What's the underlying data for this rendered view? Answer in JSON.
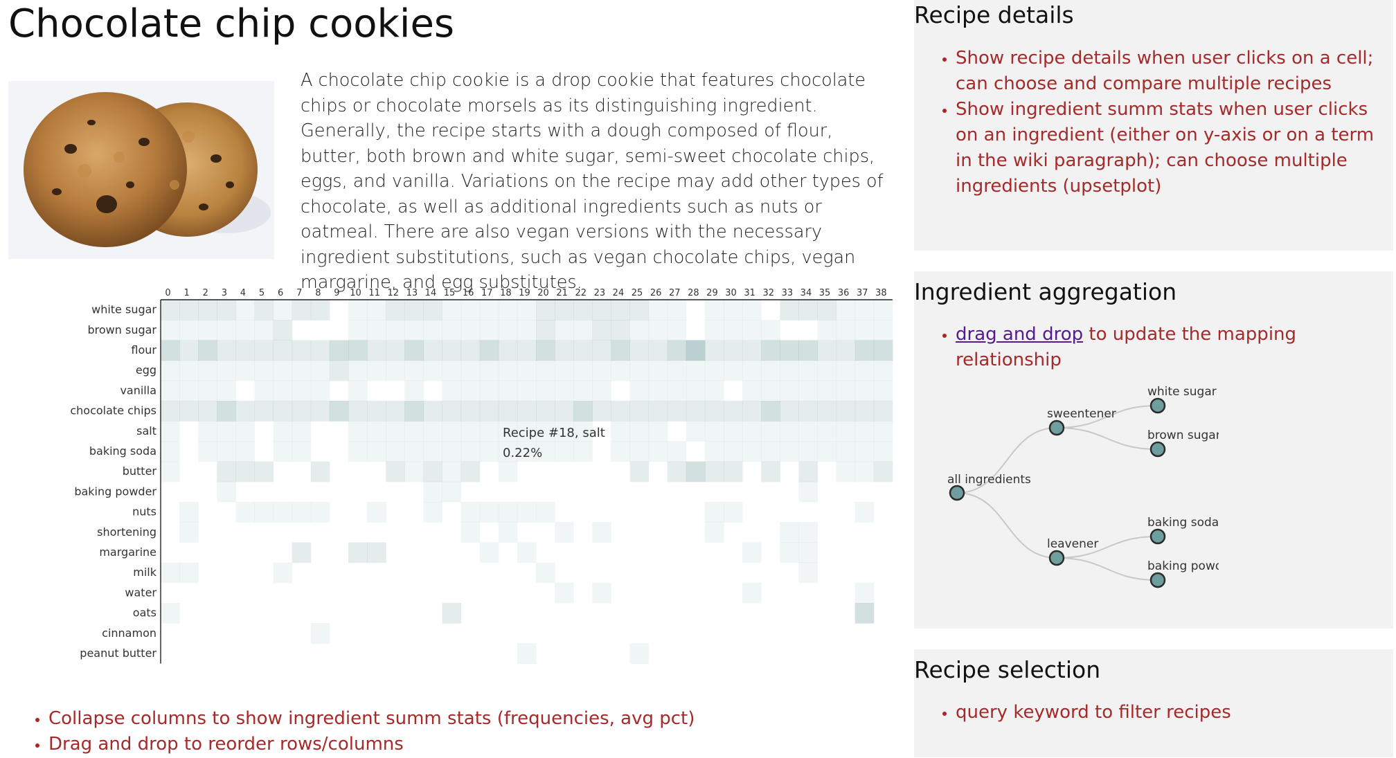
{
  "page": {
    "title": "Chocolate chip cookies",
    "intro": "A chocolate chip cookie is a drop cookie that features chocolate chips or chocolate morsels as its distinguishing ingredient. Generally, the recipe starts with a dough composed of flour, butter, both brown and white sugar, semi-sweet chocolate chips, eggs, and vanilla. Variations on the recipe may add other types of chocolate, as well as additional ingredients such as nuts or oatmeal. There are also vegan versions with the necessary ingredient substitutions, such as vegan chocolate chips, vegan margarine, and egg substitutes."
  },
  "heatmap": {
    "columns": [
      "0",
      "1",
      "2",
      "3",
      "4",
      "5",
      "6",
      "7",
      "8",
      "9",
      "10",
      "11",
      "12",
      "13",
      "14",
      "15",
      "16",
      "17",
      "18",
      "19",
      "20",
      "21",
      "22",
      "23",
      "24",
      "25",
      "26",
      "27",
      "28",
      "29",
      "30",
      "31",
      "32",
      "33",
      "34",
      "35",
      "36",
      "37",
      "38"
    ],
    "rows": [
      "white sugar",
      "brown sugar",
      "flour",
      "egg",
      "vanilla",
      "chocolate chips",
      "salt",
      "baking soda",
      "butter",
      "baking powder",
      "nuts",
      "shortening",
      "margarine",
      "milk",
      "water",
      "oats",
      "cinnamon",
      "peanut butter"
    ],
    "color": "#5e8e8e",
    "tooltip": {
      "line1": "Recipe #18, salt",
      "line2": "0.22%"
    }
  },
  "notes": [
    "Collapse columns to show ingredient summ stats (frequencies, avg pct)",
    "Drag and drop to reorder rows/columns"
  ],
  "panels": {
    "details": {
      "title": "Recipe details",
      "items": [
        "Show recipe details when user clicks on a cell; can choose and compare multiple recipes",
        "Show ingredient summ stats when user clicks on an ingredient (either on y-axis or on a term in the wiki paragraph); can choose multiple ingredients (upsetplot)"
      ]
    },
    "aggregation": {
      "title": "Ingredient aggregation",
      "link": "drag and drop",
      "rest": " to update the mapping relationship",
      "tree": {
        "root": "all ingredients",
        "groups": [
          {
            "label": "sweentener",
            "children": [
              "white sugar",
              "brown sugar"
            ]
          },
          {
            "label": "leavener",
            "children": [
              "baking soda",
              "baking powder"
            ]
          }
        ]
      },
      "node_color": "#6f9e9e"
    },
    "selection": {
      "title": "Recipe selection",
      "items": [
        "query keyword to filter recipes"
      ]
    }
  }
}
